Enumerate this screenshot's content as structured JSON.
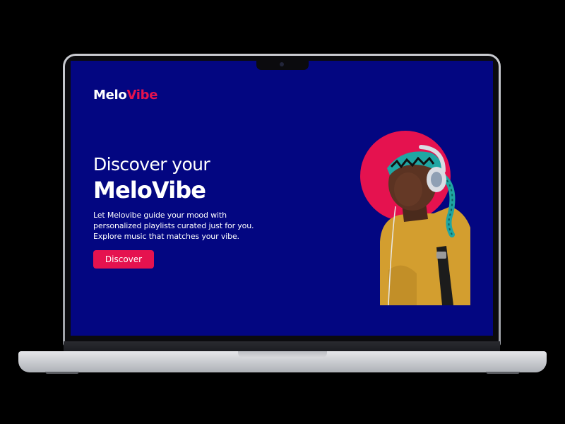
{
  "app": {
    "logo_part1": "Melo",
    "logo_part2": "Vibe"
  },
  "hero": {
    "title_line1": "Discover your",
    "title_line2": "MeloVibe",
    "description_lines": [
      "Let Melovibe guide your mood with",
      "personalized playlists curated just for you.",
      "Explore music that matches your vibe."
    ],
    "cta_label": "Discover",
    "image_subject": "person-wearing-headphones"
  },
  "colors": {
    "background": "#030681",
    "accent": "#e5124f",
    "text": "#ffffff",
    "device_frame": "#b8babf"
  },
  "icons": {
    "camera": "camera-icon"
  }
}
